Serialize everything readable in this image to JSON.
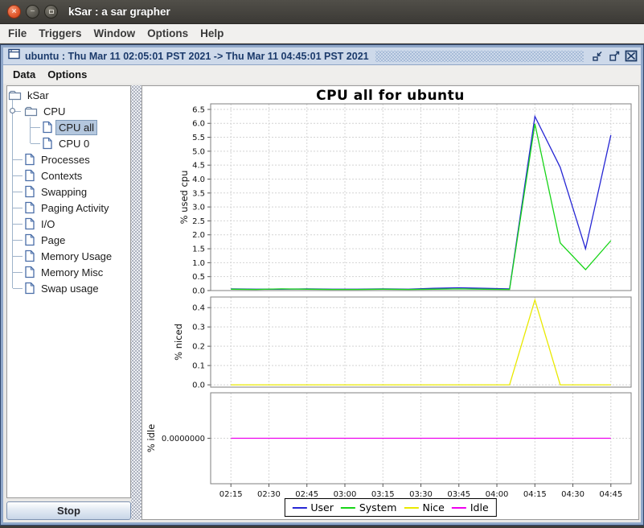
{
  "window": {
    "title": "kSar : a sar grapher"
  },
  "titlebar_buttons": {
    "close": "×",
    "minimize": "−"
  },
  "menubar": {
    "items": [
      "File",
      "Triggers",
      "Window",
      "Options",
      "Help"
    ]
  },
  "inner_window": {
    "title": "ubuntu : Thu Mar 11 02:05:01 PST 2021 -> Thu Mar 11 04:45:01 PST 2021",
    "menu_items": [
      "Data",
      "Options"
    ]
  },
  "sidebar": {
    "tree": [
      {
        "label": "kSar",
        "icon": "folder",
        "depth": 0
      },
      {
        "label": "CPU",
        "icon": "folder",
        "depth": 1,
        "expander": true
      },
      {
        "label": "CPU all",
        "icon": "doc",
        "depth": 2,
        "selected": true
      },
      {
        "label": "CPU 0",
        "icon": "doc",
        "depth": 2
      },
      {
        "label": "Processes",
        "icon": "doc",
        "depth": 1
      },
      {
        "label": "Contexts",
        "icon": "doc",
        "depth": 1
      },
      {
        "label": "Swapping",
        "icon": "doc",
        "depth": 1
      },
      {
        "label": "Paging Activity",
        "icon": "doc",
        "depth": 1
      },
      {
        "label": "I/O",
        "icon": "doc",
        "depth": 1
      },
      {
        "label": "Page",
        "icon": "doc",
        "depth": 1
      },
      {
        "label": "Memory Usage",
        "icon": "doc",
        "depth": 1
      },
      {
        "label": "Memory Misc",
        "icon": "doc",
        "depth": 1
      },
      {
        "label": "Swap usage",
        "icon": "doc",
        "depth": 1
      }
    ],
    "stop_label": "Stop"
  },
  "chart_data": {
    "type": "line",
    "title": "CPU all for ubuntu",
    "x_domain": [
      "02:07",
      "04:53"
    ],
    "x_ticks": [
      "02:15",
      "02:30",
      "02:45",
      "03:00",
      "03:15",
      "03:30",
      "03:45",
      "04:00",
      "04:15",
      "04:30",
      "04:45"
    ],
    "x_points": [
      "02:15",
      "02:25",
      "02:35",
      "02:45",
      "02:55",
      "03:05",
      "03:15",
      "03:25",
      "03:35",
      "03:45",
      "03:55",
      "04:05",
      "04:15",
      "04:25",
      "04:35",
      "04:45"
    ],
    "grid": true,
    "legend_position": "bottom",
    "legend": [
      {
        "label": "User",
        "color": "#2727d4"
      },
      {
        "label": "System",
        "color": "#17d417"
      },
      {
        "label": "Nice",
        "color": "#e9e900"
      },
      {
        "label": "Idle",
        "color": "#ee00ee"
      }
    ],
    "subplots": [
      {
        "ylabel": "% used cpu",
        "ylim": [
          0,
          6.7
        ],
        "yticks": [
          "0.0",
          "0.5",
          "1.0",
          "1.5",
          "2.0",
          "2.5",
          "3.0",
          "3.5",
          "4.0",
          "4.5",
          "5.0",
          "5.5",
          "6.0",
          "6.5"
        ],
        "series": [
          {
            "name": "User",
            "color": "#2727d4",
            "values": [
              0.06,
              0.05,
              0.05,
              0.06,
              0.05,
              0.05,
              0.06,
              0.05,
              0.08,
              0.1,
              0.08,
              0.06,
              6.25,
              4.42,
              1.5,
              5.58
            ]
          },
          {
            "name": "System",
            "color": "#17d417",
            "values": [
              0.05,
              0.04,
              0.06,
              0.05,
              0.04,
              0.04,
              0.05,
              0.04,
              0.05,
              0.06,
              0.05,
              0.04,
              5.98,
              1.71,
              0.75,
              1.79
            ]
          }
        ]
      },
      {
        "ylabel": "% niced",
        "ylim": [
          -0.012,
          0.455
        ],
        "yticks": [
          "0.0",
          "0.1",
          "0.2",
          "0.3",
          "0.4"
        ],
        "series": [
          {
            "name": "Nice",
            "color": "#e9e900",
            "values": [
              0,
              0,
              0,
              0,
              0,
              0,
              0,
              0,
              0,
              0,
              0,
              0,
              0.44,
              0,
              0,
              0
            ]
          }
        ]
      },
      {
        "ylabel": "% idle",
        "ylim": [
          -1,
          1
        ],
        "yticks": [
          "0.0000000"
        ],
        "series": [
          {
            "name": "Idle",
            "color": "#ee00ee",
            "values": [
              0,
              0,
              0,
              0,
              0,
              0,
              0,
              0,
              0,
              0,
              0,
              0,
              0,
              0,
              0,
              0
            ]
          }
        ]
      }
    ]
  }
}
